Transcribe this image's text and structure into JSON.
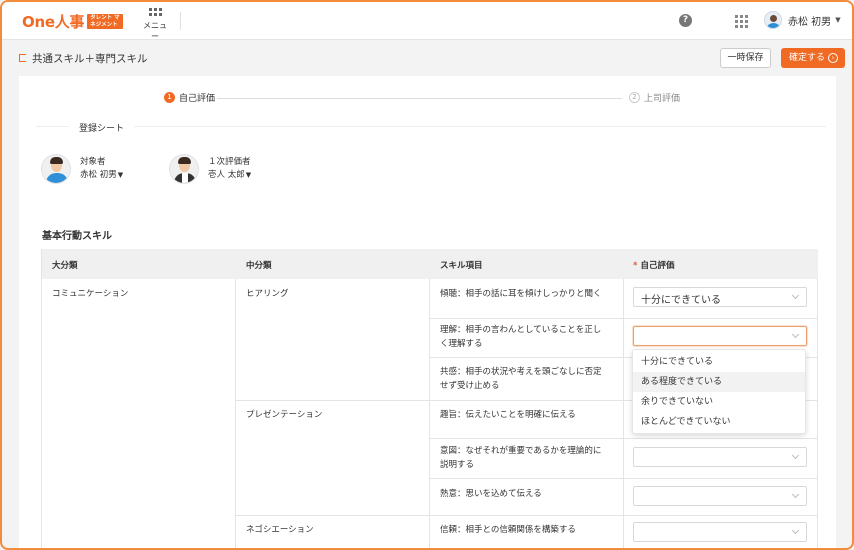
{
  "header": {
    "logo_text": "One人事",
    "logo_badge": "タレント マネジメント",
    "menu_label": "メニュー",
    "help_symbol": "?",
    "user_name": "赤松 初男",
    "caret": "▼"
  },
  "titlebar": {
    "title": "共通スキル＋専門スキル",
    "save_label": "一時保存",
    "confirm_label": "確定する",
    "confirm_icon_symbol": "›"
  },
  "steps": [
    {
      "num": "1",
      "label": "自己評価",
      "active": true
    },
    {
      "num": "2",
      "label": "上司評価",
      "active": false
    }
  ],
  "sheet": {
    "label": "登録シート",
    "target": {
      "role": "対象者",
      "name": "赤松 初男",
      "caret": "▼"
    },
    "evaluator": {
      "role": "１次評価者",
      "name": "壱人 太郎",
      "caret": "▼"
    }
  },
  "section_title": "基本行動スキル",
  "table": {
    "headers": {
      "col1": "大分類",
      "col2": "中分類",
      "col3": "スキル項目",
      "col4_required": "*",
      "col4": "自己評価"
    },
    "category": "コミュニケーション",
    "subcategories": [
      "ヒアリング",
      "プレゼンテーション",
      "ネゴシエーション"
    ],
    "items": [
      {
        "line1": "傾聴：相手の話に耳を傾けしっかりと聞く",
        "line2": "",
        "value": "十分にできている"
      },
      {
        "line1": "理解：相手の言わんとしていることを正し",
        "line2": "く理解する",
        "value": ""
      },
      {
        "line1": "共感：相手の状況や考えを頭ごなしに否定",
        "line2": "せず受け止める",
        "value": ""
      },
      {
        "line1": "趣旨：伝えたいことを明確に伝える",
        "line2": "",
        "value": ""
      },
      {
        "line1": "意図：なぜそれが重要であるかを理論的に",
        "line2": "説明する",
        "value": ""
      },
      {
        "line1": "熱意：思いを込めて伝える",
        "line2": "",
        "value": ""
      },
      {
        "line1": "信頼：相手との信頼関係を構築する",
        "line2": "",
        "value": ""
      }
    ]
  },
  "dropdown": {
    "options": [
      "十分にできている",
      "ある程度できている",
      "余りできていない",
      "ほとんどできていない"
    ],
    "hovered_index": 1
  },
  "colors": {
    "accent": "#f06a23",
    "frame": "#f28c3a"
  }
}
